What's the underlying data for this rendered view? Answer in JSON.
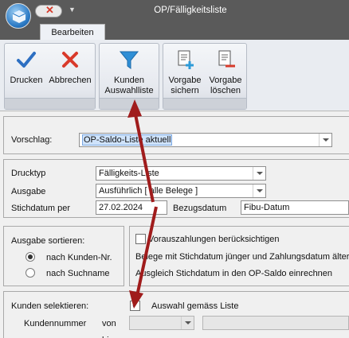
{
  "window": {
    "title": "OP/Fälligkeitsliste"
  },
  "ribbon": {
    "tabs": [
      {
        "label": "Bearbeiten"
      }
    ],
    "buttons": {
      "drucken": "Drucken",
      "abbrechen": "Abbrechen",
      "kunden_line1": "Kunden",
      "kunden_line2": "Auswahlliste",
      "vorgabe_sichern_line1": "Vorgabe",
      "vorgabe_sichern_line2": "sichern",
      "vorgabe_loeschen_line1": "Vorgabe",
      "vorgabe_loeschen_line2": "löschen"
    }
  },
  "form": {
    "vorschlag": {
      "label": "Vorschlag:",
      "value": "OP-Saldo-Liste aktuell"
    },
    "drucktyp": {
      "label": "Drucktyp",
      "value": "Fälligkeits-Liste"
    },
    "ausgabe": {
      "label": "Ausgabe",
      "value": "Ausführlich [ alle Belege ]"
    },
    "stichdatum": {
      "label": "Stichdatum per",
      "value": "27.02.2024"
    },
    "bezugsdatum": {
      "label": "Bezugsdatum",
      "value": "Fibu-Datum"
    },
    "sortieren": {
      "label": "Ausgabe sortieren:",
      "options": [
        {
          "label": "nach Kunden-Nr.",
          "selected": true
        },
        {
          "label": "nach Suchname",
          "selected": false
        }
      ]
    },
    "vorauszahlungen": {
      "label": "Vorauszahlungen berücksichtigen",
      "checked": false
    },
    "belege_text": "Belege mit Stichdatum jünger und Zahlungsdatum älter",
    "ausgleich_text": "Ausgleich Stichdatum in den OP-Saldo einrechnen",
    "kunden_selektieren": {
      "label": "Kunden selektieren:"
    },
    "auswahl_liste": {
      "label": "Auswahl gemäss Liste",
      "checked": true
    },
    "kundennummer": {
      "label": "Kundennummer",
      "von": "von",
      "bis": "bis"
    }
  },
  "colors": {
    "annotation_arrow": "#a01c1c",
    "titlebar": "#5a5a5a"
  }
}
